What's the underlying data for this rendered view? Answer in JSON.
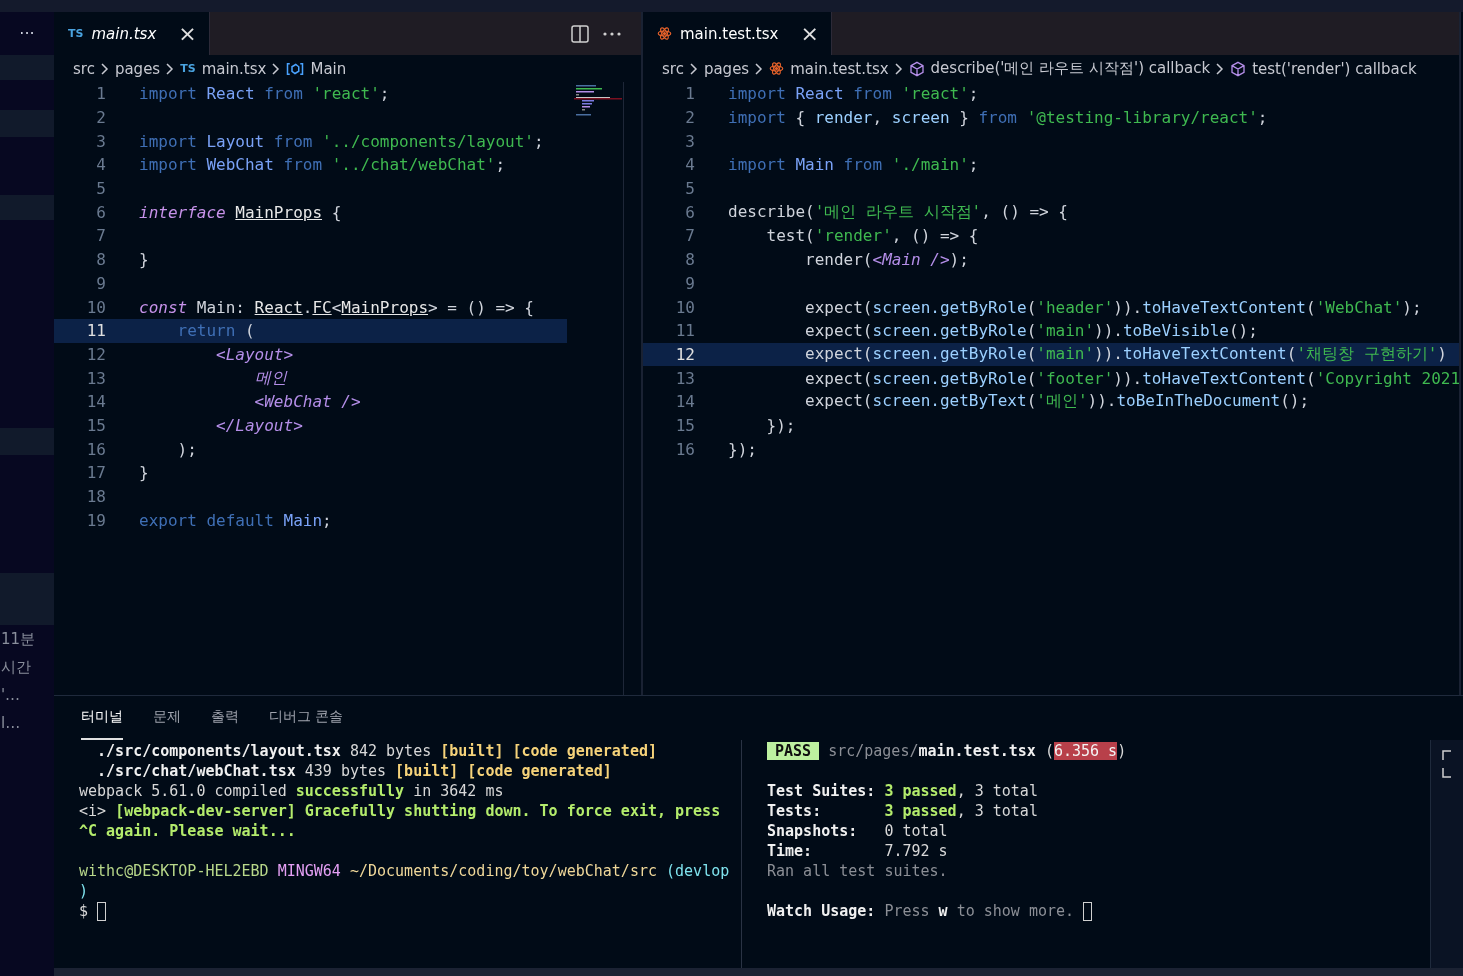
{
  "sidebar": {
    "more": "···",
    "items": [
      "11분",
      "시간",
      "'…",
      "l…"
    ]
  },
  "editors": [
    {
      "tabs": [
        {
          "kind": "ts",
          "badge": "TS",
          "label": "main.tsx",
          "selected": true,
          "italic": true,
          "close": "×"
        }
      ],
      "actions": true,
      "breadcrumbs": [
        {
          "kind": "folder",
          "label": "src"
        },
        {
          "kind": "folder",
          "label": "pages"
        },
        {
          "kind": "ts",
          "badge": "TS",
          "label": "main.tsx"
        },
        {
          "kind": "symbol",
          "label": "Main"
        }
      ],
      "minimap": true,
      "lines": [
        {
          "number": "1",
          "current": false,
          "tokens": [
            {
              "kind": "kw",
              "text": "import"
            },
            {
              "kind": "id",
              "text": " React"
            },
            {
              "kind": "kw",
              "text": " from"
            },
            {
              "kind": "str",
              "text": " 'react'"
            },
            {
              "kind": "plain",
              "text": ";"
            }
          ]
        },
        {
          "number": "2",
          "current": false
        },
        {
          "number": "3",
          "current": false,
          "tokens": [
            {
              "kind": "kw",
              "text": "import"
            },
            {
              "kind": "id",
              "text": " Layout"
            },
            {
              "kind": "kw",
              "text": " from"
            },
            {
              "kind": "str",
              "text": " '../components/layout'"
            },
            {
              "kind": "plain",
              "text": ";"
            }
          ]
        },
        {
          "number": "4",
          "current": false,
          "tokens": [
            {
              "kind": "kw",
              "text": "import"
            },
            {
              "kind": "id",
              "text": " WebChat"
            },
            {
              "kind": "kw",
              "text": " from"
            },
            {
              "kind": "str",
              "text": " '../chat/webChat'"
            },
            {
              "kind": "plain",
              "text": ";"
            }
          ]
        },
        {
          "number": "5",
          "current": false
        },
        {
          "number": "6",
          "current": false,
          "tokens": [
            {
              "kind": "decl",
              "text": "interface "
            },
            {
              "kind": "type",
              "text": "MainProps"
            },
            {
              "kind": "plain",
              "text": " {"
            }
          ]
        },
        {
          "number": "7",
          "current": false
        },
        {
          "number": "8",
          "current": false,
          "tokens": [
            {
              "kind": "plain",
              "text": "}"
            }
          ]
        },
        {
          "number": "9",
          "current": false
        },
        {
          "number": "10",
          "current": false,
          "tokens": [
            {
              "kind": "decl",
              "text": "const"
            },
            {
              "kind": "plain",
              "text": " Main: "
            },
            {
              "kind": "type",
              "text": "React"
            },
            {
              "kind": "plain",
              "text": "."
            },
            {
              "kind": "type",
              "text": "FC"
            },
            {
              "kind": "plain",
              "text": "<"
            },
            {
              "kind": "type",
              "text": "MainProps"
            },
            {
              "kind": "plain",
              "text": "> = () => {"
            }
          ]
        },
        {
          "number": "11",
          "current": true,
          "tokens": [
            {
              "kind": "kw",
              "text": "    return"
            },
            {
              "kind": "plain",
              "text": " ("
            }
          ]
        },
        {
          "number": "12",
          "current": false,
          "tokens": [
            {
              "kind": "tag",
              "text": "        <Layout>"
            }
          ]
        },
        {
          "number": "13",
          "current": false,
          "tokens": [
            {
              "kind": "tag",
              "text": "            메인"
            }
          ]
        },
        {
          "number": "14",
          "current": false,
          "tokens": [
            {
              "kind": "tag",
              "text": "            <WebChat />"
            }
          ]
        },
        {
          "number": "15",
          "current": false,
          "tokens": [
            {
              "kind": "tag",
              "text": "        </Layout>"
            }
          ]
        },
        {
          "number": "16",
          "current": false,
          "tokens": [
            {
              "kind": "plain",
              "text": "    );"
            }
          ]
        },
        {
          "number": "17",
          "current": false,
          "tokens": [
            {
              "kind": "plain",
              "text": "}"
            }
          ]
        },
        {
          "number": "18",
          "current": false
        },
        {
          "number": "19",
          "current": false,
          "tokens": [
            {
              "kind": "kw",
              "text": "export default"
            },
            {
              "kind": "id",
              "text": " Main"
            },
            {
              "kind": "plain",
              "text": ";"
            }
          ]
        }
      ]
    },
    {
      "tabs": [
        {
          "kind": "react",
          "label": "main.test.tsx",
          "selected": true,
          "italic": false,
          "close": "×"
        }
      ],
      "actions": false,
      "breadcrumbs": [
        {
          "kind": "folder",
          "label": "src"
        },
        {
          "kind": "folder",
          "label": "pages"
        },
        {
          "kind": "react",
          "label": "main.test.tsx"
        },
        {
          "kind": "callback",
          "label": "describe('메인 라우트 시작점') callback"
        },
        {
          "kind": "callback",
          "label": "test('render') callback"
        }
      ],
      "minimap": false,
      "lines": [
        {
          "number": "1",
          "current": false,
          "tokens": [
            {
              "kind": "kw",
              "text": "import"
            },
            {
              "kind": "id",
              "text": " React"
            },
            {
              "kind": "kw",
              "text": " from"
            },
            {
              "kind": "str",
              "text": " 'react'"
            },
            {
              "kind": "plain",
              "text": ";"
            }
          ]
        },
        {
          "number": "2",
          "current": false,
          "tokens": [
            {
              "kind": "kw",
              "text": "import"
            },
            {
              "kind": "plain",
              "text": " { "
            },
            {
              "kind": "var",
              "text": "render"
            },
            {
              "kind": "plain",
              "text": ", "
            },
            {
              "kind": "var",
              "text": "screen"
            },
            {
              "kind": "plain",
              "text": " } "
            },
            {
              "kind": "kw",
              "text": "from"
            },
            {
              "kind": "str",
              "text": " '@testing-library/react'"
            },
            {
              "kind": "plain",
              "text": ";"
            }
          ]
        },
        {
          "number": "3",
          "current": false
        },
        {
          "number": "4",
          "current": false,
          "tokens": [
            {
              "kind": "kw",
              "text": "import"
            },
            {
              "kind": "id",
              "text": " Main"
            },
            {
              "kind": "kw",
              "text": " from"
            },
            {
              "kind": "str",
              "text": " './main'"
            },
            {
              "kind": "plain",
              "text": ";"
            }
          ]
        },
        {
          "number": "5",
          "current": false
        },
        {
          "number": "6",
          "current": false,
          "tokens": [
            {
              "kind": "plain",
              "text": "describe("
            },
            {
              "kind": "str",
              "text": "'메인 라우트 시작점'"
            },
            {
              "kind": "plain",
              "text": ", () => {"
            }
          ]
        },
        {
          "number": "7",
          "current": false,
          "tokens": [
            {
              "kind": "plain",
              "text": "    test("
            },
            {
              "kind": "str",
              "text": "'render'"
            },
            {
              "kind": "plain",
              "text": ", () => {"
            }
          ]
        },
        {
          "number": "8",
          "current": false,
          "tokens": [
            {
              "kind": "plain",
              "text": "        render("
            },
            {
              "kind": "tag",
              "text": "<Main />"
            },
            {
              "kind": "plain",
              "text": ");"
            }
          ]
        },
        {
          "number": "9",
          "current": false
        },
        {
          "number": "10",
          "current": false,
          "tokens": [
            {
              "kind": "plain",
              "text": "        expect("
            },
            {
              "kind": "var",
              "text": "screen.getByRole"
            },
            {
              "kind": "plain",
              "text": "("
            },
            {
              "kind": "str",
              "text": "'header'"
            },
            {
              "kind": "plain",
              "text": "))."
            },
            {
              "kind": "var",
              "text": "toHaveTextContent"
            },
            {
              "kind": "plain",
              "text": "("
            },
            {
              "kind": "str",
              "text": "'WebChat'"
            },
            {
              "kind": "plain",
              "text": ");"
            }
          ]
        },
        {
          "number": "11",
          "current": false,
          "tokens": [
            {
              "kind": "plain",
              "text": "        expect("
            },
            {
              "kind": "var",
              "text": "screen.getByRole"
            },
            {
              "kind": "plain",
              "text": "("
            },
            {
              "kind": "str",
              "text": "'main'"
            },
            {
              "kind": "plain",
              "text": "))."
            },
            {
              "kind": "var",
              "text": "toBeVisible"
            },
            {
              "kind": "plain",
              "text": "();"
            }
          ]
        },
        {
          "number": "12",
          "current": true,
          "tokens": [
            {
              "kind": "plain",
              "text": "        expect("
            },
            {
              "kind": "var",
              "text": "screen.getByRole"
            },
            {
              "kind": "plain",
              "text": "("
            },
            {
              "kind": "str",
              "text": "'main'"
            },
            {
              "kind": "plain",
              "text": "))."
            },
            {
              "kind": "var",
              "text": "toHaveTextContent"
            },
            {
              "kind": "plain",
              "text": "("
            },
            {
              "kind": "str",
              "text": "'채팅창 구현하기'"
            },
            {
              "kind": "plain",
              "text": ")"
            }
          ]
        },
        {
          "number": "13",
          "current": false,
          "tokens": [
            {
              "kind": "plain",
              "text": "        expect("
            },
            {
              "kind": "var",
              "text": "screen.getByRole"
            },
            {
              "kind": "plain",
              "text": "("
            },
            {
              "kind": "str",
              "text": "'footer'"
            },
            {
              "kind": "plain",
              "text": "))."
            },
            {
              "kind": "var",
              "text": "toHaveTextContent"
            },
            {
              "kind": "plain",
              "text": "("
            },
            {
              "kind": "str",
              "text": "'Copyright 2021"
            }
          ]
        },
        {
          "number": "14",
          "current": false,
          "tokens": [
            {
              "kind": "plain",
              "text": "        expect("
            },
            {
              "kind": "var",
              "text": "screen.getByText"
            },
            {
              "kind": "plain",
              "text": "("
            },
            {
              "kind": "str",
              "text": "'메인'"
            },
            {
              "kind": "plain",
              "text": "))."
            },
            {
              "kind": "var",
              "text": "toBeInTheDocument"
            },
            {
              "kind": "plain",
              "text": "();"
            }
          ]
        },
        {
          "number": "15",
          "current": false,
          "tokens": [
            {
              "kind": "plain",
              "text": "    });"
            }
          ]
        },
        {
          "number": "16",
          "current": false,
          "tokens": [
            {
              "kind": "plain",
              "text": "});"
            }
          ]
        }
      ]
    }
  ],
  "panel": {
    "tabs": [
      {
        "label": "터미널",
        "selected": true
      },
      {
        "label": "문제",
        "selected": false
      },
      {
        "label": "출력",
        "selected": false
      },
      {
        "label": "디버그 콘솔",
        "selected": false
      }
    ],
    "terminals": [
      {
        "cursor": true,
        "lines": [
          {
            "kind": "text",
            "segments": [
              {
                "kind": "bold",
                "text": "  ./src/components/layout.tsx"
              },
              {
                "kind": "plain",
                "text": " 842 bytes "
              },
              {
                "kind": "yellow",
                "text": "[built] [code generated]"
              }
            ]
          },
          {
            "kind": "text",
            "segments": [
              {
                "kind": "bold",
                "text": "  ./src/chat/webChat.tsx"
              },
              {
                "kind": "plain",
                "text": " 439 bytes "
              },
              {
                "kind": "yellow",
                "text": "[built] [code generated]"
              }
            ]
          },
          {
            "kind": "text",
            "segments": [
              {
                "kind": "plain",
                "text": "webpack 5.61.0 compiled "
              },
              {
                "kind": "green",
                "text": "successfully"
              },
              {
                "kind": "plain",
                "text": " in 3642 ms"
              }
            ]
          },
          {
            "kind": "text",
            "segments": [
              {
                "kind": "plain",
                "text": "<i> "
              },
              {
                "kind": "green",
                "text": "[webpack-dev-server] Gracefully shutting down. To force exit, press"
              }
            ]
          },
          {
            "kind": "text",
            "segments": [
              {
                "kind": "green",
                "text": "^C again. Please wait..."
              }
            ]
          },
          {
            "kind": "blank"
          },
          {
            "kind": "text",
            "segments": [
              {
                "kind": "user",
                "text": "withc@DESKTOP-HEL2EBD"
              },
              {
                "kind": "purple",
                "text": " MINGW64"
              },
              {
                "kind": "path",
                "text": " ~/Documents/coding/toy/webChat/src"
              },
              {
                "kind": "cyan",
                "text": " (devlop"
              }
            ]
          },
          {
            "kind": "text",
            "segments": [
              {
                "kind": "cyan",
                "text": ")"
              }
            ]
          },
          {
            "kind": "text",
            "segments": [
              {
                "kind": "plain",
                "text": "$"
              }
            ]
          }
        ]
      },
      {
        "cursor": true,
        "lines": [
          {
            "kind": "text",
            "segments": [
              {
                "kind": "badge",
                "text": "PASS"
              },
              {
                "kind": "dim",
                "text": " src/pages/"
              },
              {
                "kind": "bold",
                "text": "main.test.tsx"
              },
              {
                "kind": "plain",
                "text": " ("
              },
              {
                "kind": "slow",
                "text": "6.356 s"
              },
              {
                "kind": "plain",
                "text": ")"
              }
            ]
          },
          {
            "kind": "blank"
          },
          {
            "kind": "text",
            "segments": [
              {
                "kind": "bold",
                "text": "Test Suites: "
              },
              {
                "kind": "green",
                "text": "3 passed"
              },
              {
                "kind": "plain",
                "text": ", 3 total"
              }
            ]
          },
          {
            "kind": "text",
            "segments": [
              {
                "kind": "bold",
                "text": "Tests:       "
              },
              {
                "kind": "green",
                "text": "3 passed"
              },
              {
                "kind": "plain",
                "text": ", 3 total"
              }
            ]
          },
          {
            "kind": "text",
            "segments": [
              {
                "kind": "bold",
                "text": "Snapshots:   "
              },
              {
                "kind": "plain",
                "text": "0 total"
              }
            ]
          },
          {
            "kind": "text",
            "segments": [
              {
                "kind": "bold",
                "text": "Time:        "
              },
              {
                "kind": "plain",
                "text": "7.792 s"
              }
            ]
          },
          {
            "kind": "text",
            "segments": [
              {
                "kind": "dim",
                "text": "Ran all test suites."
              }
            ]
          },
          {
            "kind": "blank"
          },
          {
            "kind": "text",
            "segments": [
              {
                "kind": "bold",
                "text": "Watch Usage: "
              },
              {
                "kind": "dim",
                "text": "Press "
              },
              {
                "kind": "bold",
                "text": "w"
              },
              {
                "kind": "dim",
                "text": " to show more."
              }
            ]
          }
        ]
      }
    ]
  }
}
